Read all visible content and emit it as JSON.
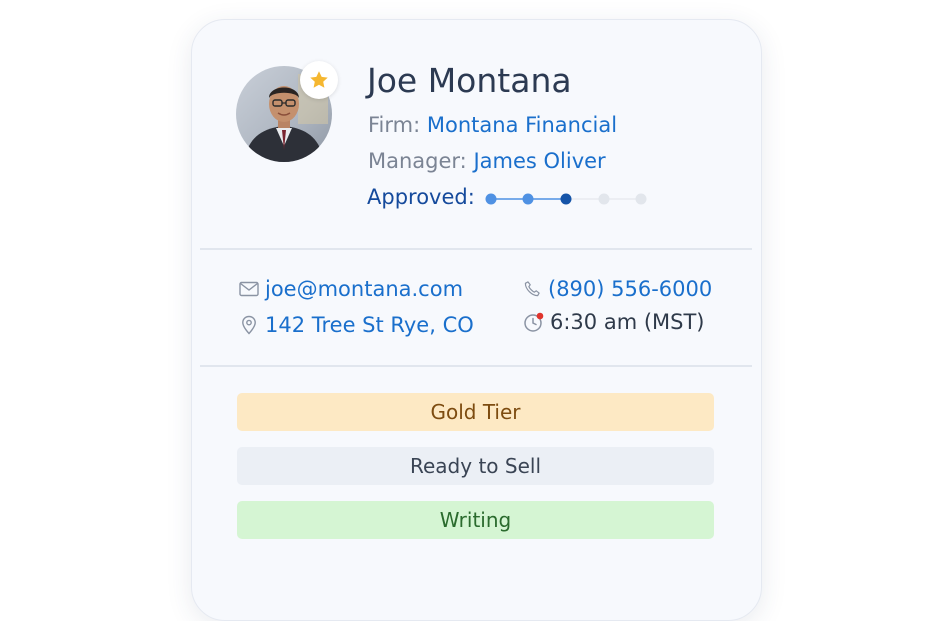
{
  "profile": {
    "name": "Joe Montana",
    "firm_label": "Firm:",
    "firm_value": "Montana Financial",
    "manager_label": "Manager:",
    "manager_value": "James Oliver",
    "approved_label": "Approved:",
    "approval_progress": {
      "completed_steps": 3,
      "total_steps": 5
    },
    "avatar_icon": "person-photo",
    "badge_icon": "star-icon"
  },
  "contact": {
    "email": "joe@montana.com",
    "address": "142 Tree St Rye, CO",
    "phone": "(890) 556-6000",
    "local_time": "6:30 am (MST)",
    "icons": [
      "mail-icon",
      "location-pin-icon",
      "phone-icon",
      "clock-icon"
    ]
  },
  "tags": [
    {
      "label": "Gold Tier",
      "bg": "#fde9c4",
      "fg": "#7d4c10"
    },
    {
      "label": "Ready to Sell",
      "bg": "#ebeff5",
      "fg": "#3a4454"
    },
    {
      "label": "Writing",
      "bg": "#d5f5d3",
      "fg": "#2b6b2e"
    }
  ],
  "colors": {
    "accent_link": "#1a6fcc",
    "approved_text": "#154a9c",
    "progress_done": "#4f91e3",
    "progress_current": "#1554a8",
    "progress_pending": "#e2e6ec",
    "star": "#f5b730",
    "clock_alert": "#e0342d"
  }
}
